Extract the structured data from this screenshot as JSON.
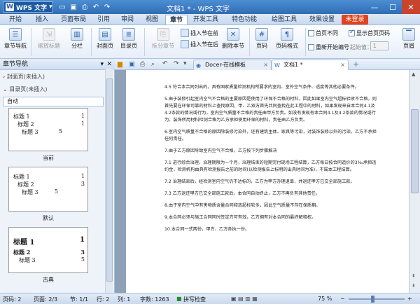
{
  "app": {
    "name": "WPS 文字",
    "title": "文档1 * - WPS 文字"
  },
  "menu": {
    "tabs": [
      "开始",
      "插入",
      "页面布局",
      "引用",
      "审阅",
      "视图",
      "章节",
      "开发工具",
      "特色功能",
      "绘图工具",
      "效果设置"
    ],
    "active": "章节",
    "login": "未登录"
  },
  "ribbon": {
    "nav_pane": "章节导航",
    "shrink_title": "缩放标题",
    "section": "分栏",
    "cover": "封面页",
    "toc_page": "目录页",
    "split_section": "拆分章节",
    "insert_before": "插入节在前",
    "insert_after": "插入节在后",
    "delete_section": "删除本节",
    "page_number": "页码",
    "page_format": "页码格式",
    "first_diff": "首页不同",
    "show_first_page_number": "显示首页页码",
    "renumber": "重新开始编号",
    "start_at_label": "起始值：",
    "start_at_value": "1",
    "header": "页眉"
  },
  "sidebar": {
    "title": "章节导航",
    "cover_section": "封面页(未插入)",
    "toc_section": "目录页(未插入)",
    "auto_label": "自动",
    "styles": [
      {
        "caption": "当前",
        "lines": [
          [
            "标题 1",
            "1"
          ],
          [
            "标题 2",
            "1"
          ],
          [
            "标题 3",
            "5"
          ]
        ]
      },
      {
        "caption": "默认",
        "lines": [
          [
            "标题 1",
            "1"
          ],
          [
            "标题 2",
            "3"
          ],
          [
            "标题 3",
            "5"
          ]
        ]
      },
      {
        "caption": "古典",
        "lines": [
          [
            "标题 1",
            "1"
          ],
          [
            "标题 2",
            "3"
          ],
          [
            "标题 3",
            "5"
          ]
        ]
      }
    ]
  },
  "doc_tabs": [
    {
      "label": "Docer-在线模板"
    },
    {
      "label": "文档1 *"
    }
  ],
  "document": {
    "paragraphs": [
      "4.5   符合本合同列出的，具有国家质量检测机构所要求的室内、室外空气条件、适度等其他必要条件。",
      "5.由于装修引起室内空气不合格的主要原因是使用了环保不合格的材料，因此如果室内空气超标验收不合格，则首先要在环保可靠的材料上查找原因，甲、乙双方首先共同查找在此工程中的材料，如果发现来自本合同4.1及4.2条款的情况或行为，室内空气质量不合格的责任由甲方负责。如没有发现有本合同4.1及4.2条款的情况或行为，装饰所用材料检测合格为乙方承担使用环保的材料，责任由乙方负责。",
      "6.室内空气质量不合格的原因除装修污染外，还有建筑主体、家具等污染，对装饰装修以外的污染，乙方不承担任何责任。",
      "7.由于乙方原因导致室内空气不合格，乙方按下列步骤解决",
      "7.1   进行综合治理，治理期限为一个月，治理结束的短期完付现场工程结算，乙方每日按合同造价的3‰承担违约金，检测机构由具有检测报告之前的时间(以检测报告上标明的出具时间为准)，不属本工程结算。",
      "7.2   治理结束后，经检测室内空气仍不达标的，乙方为甲方办理退单，并退还甲方已交全部施工款。",
      "7.3   乙方退还甲方已交全部施工款后，本合同自动终止，乙方不再负有其他责任。",
      "8.由于室内空气中有害物质含量合同释放超标较多，因此空气质量不存在保质期。",
      "9.本合同必须与施工合同同时签定方可有效，乙方拥有对本合同的最终解释权。",
      "10.本合同一式两份，甲方、乙方各执一份。"
    ]
  },
  "status": {
    "pages": "页码: 2",
    "page_of": "页面: 2/3",
    "section": "节: 1/1",
    "row": "行: 2",
    "col": "列: 1",
    "word_count": "字数: 1263",
    "spell": "拼写检查",
    "zoom": "75 %"
  },
  "colors": {
    "accent": "#2f6db5",
    "login": "#e0431d"
  }
}
